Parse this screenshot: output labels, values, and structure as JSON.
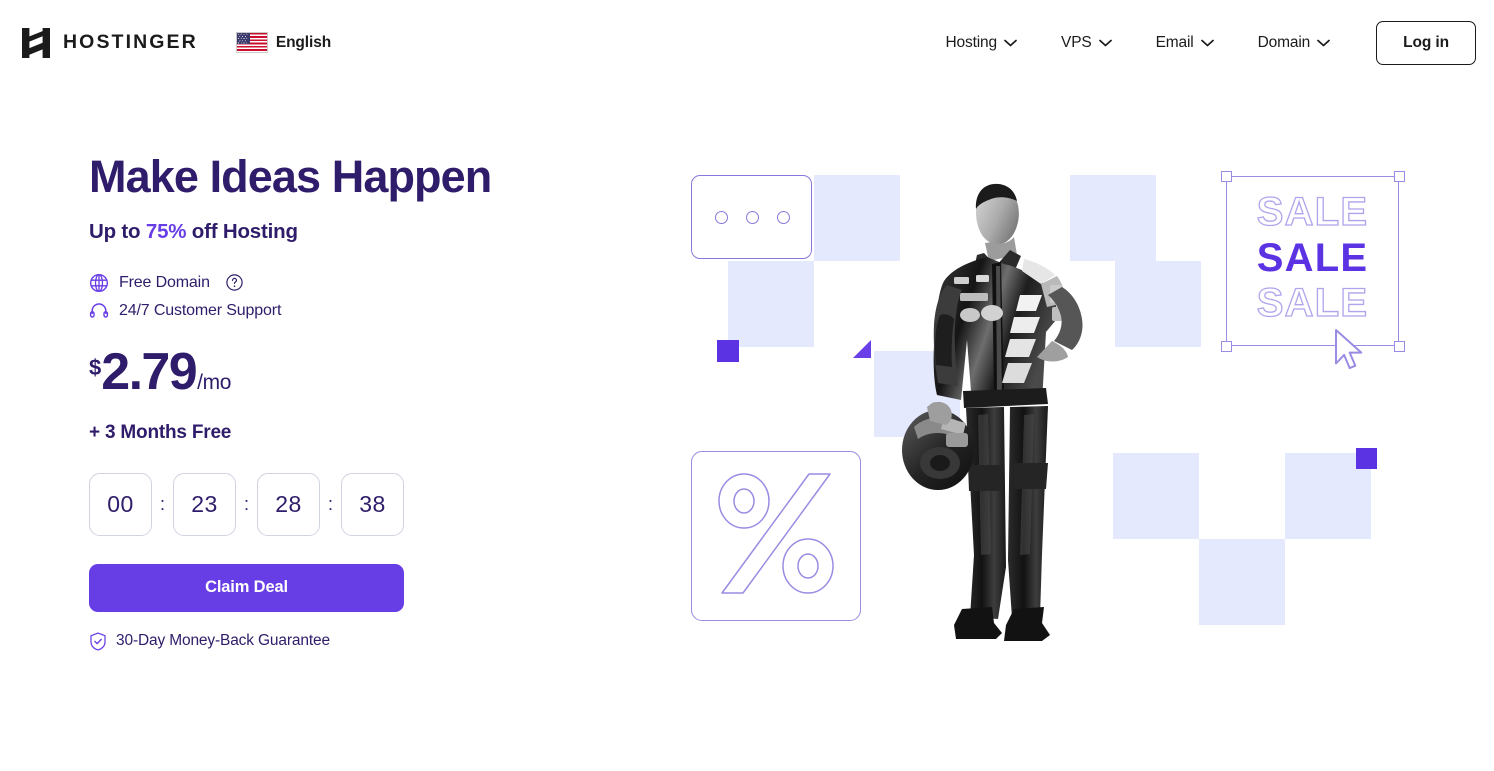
{
  "header": {
    "logo_text": "HOSTINGER",
    "logo_icon": "hostinger-h-logo",
    "language": {
      "flag_icon": "us-flag-icon",
      "label": "English",
      "chevron_icon": "chevron-down-icon"
    },
    "nav_items": [
      {
        "label": "Hosting",
        "icon": "chevron-down-icon"
      },
      {
        "label": "VPS",
        "icon": "chevron-down-icon"
      },
      {
        "label": "Email",
        "icon": "chevron-down-icon"
      },
      {
        "label": "Domain",
        "icon": "chevron-down-icon"
      }
    ],
    "login_label": "Log in"
  },
  "hero": {
    "title": "Make Ideas Happen",
    "subtitle_prefix": "Up to ",
    "subtitle_accent": "75%",
    "subtitle_suffix": " off Hosting",
    "features": [
      {
        "icon": "globe-icon",
        "label": "Free Domain",
        "help_icon": "question-mark-circle-icon"
      },
      {
        "icon": "headset-icon",
        "label": "24/7 Customer Support"
      }
    ],
    "price": {
      "currency": "$",
      "amount": "2.79",
      "period": "/mo"
    },
    "bonus": "+ 3 Months Free",
    "countdown": {
      "values": [
        "00",
        "23",
        "28",
        "38"
      ],
      "separator": ":"
    },
    "cta_label": "Claim Deal",
    "guarantee": {
      "icon": "shield-check-icon",
      "label": "30-Day Money-Back Guarantee"
    }
  },
  "artwork": {
    "browser_card_icon": "browser-window-dots",
    "percent_card_icon": "percent-symbol-outline",
    "sale_lines": [
      "SALE",
      "SALE",
      "SALE"
    ],
    "cursor_icon": "mouse-pointer-icon",
    "person_icon": "race-driver-photo"
  },
  "colors": {
    "brand_purple": "#673DE6",
    "deep_purple": "#2F1C6A",
    "lavender": "#E4E9FD",
    "outline_violet": "#9A8CE3",
    "solid_violet": "#5B33E3"
  }
}
